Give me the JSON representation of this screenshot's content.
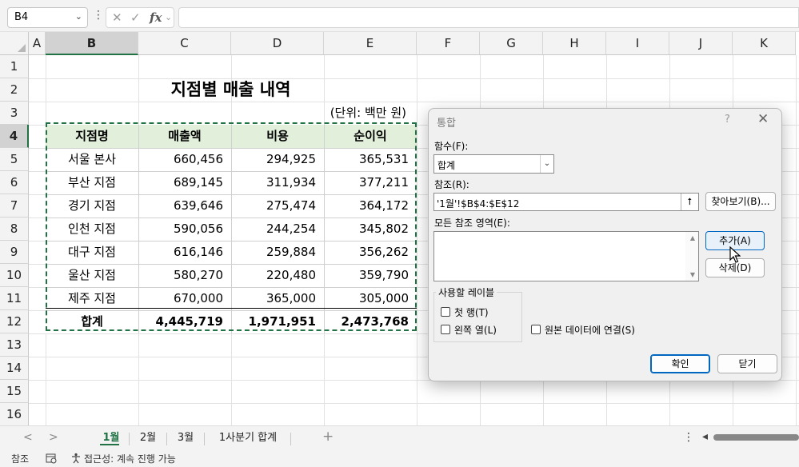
{
  "formula_bar": {
    "name_box": "B4",
    "name_box_dropdown": "⌄",
    "more": "⋮",
    "cancel_symbol": "✕",
    "enter_symbol": "✓",
    "fx_symbol": "fx",
    "fx_dropdown": "⌄",
    "formula": ""
  },
  "grid": {
    "columns": [
      "A",
      "B",
      "C",
      "D",
      "E",
      "F",
      "G",
      "H",
      "I",
      "J",
      "K"
    ],
    "rows": [
      "1",
      "2",
      "3",
      "4",
      "5",
      "6",
      "7",
      "8",
      "9",
      "10",
      "11",
      "12",
      "13",
      "14",
      "15",
      "16"
    ],
    "selected_cell": "B4"
  },
  "sheet": {
    "title": "지점별 매출 내역",
    "unit_note": "(단위: 백만 원)",
    "headers": [
      "지점명",
      "매출액",
      "비용",
      "순이익"
    ],
    "rows": [
      {
        "branch": "서울 본사",
        "sales": "660,456",
        "cost": "294,925",
        "profit": "365,531"
      },
      {
        "branch": "부산 지점",
        "sales": "689,145",
        "cost": "311,934",
        "profit": "377,211"
      },
      {
        "branch": "경기 지점",
        "sales": "639,646",
        "cost": "275,474",
        "profit": "364,172"
      },
      {
        "branch": "인천 지점",
        "sales": "590,056",
        "cost": "244,254",
        "profit": "345,802"
      },
      {
        "branch": "대구 지점",
        "sales": "616,146",
        "cost": "259,884",
        "profit": "356,262"
      },
      {
        "branch": "울산 지점",
        "sales": "580,270",
        "cost": "220,480",
        "profit": "359,790"
      },
      {
        "branch": "제주 지점",
        "sales": "670,000",
        "cost": "365,000",
        "profit": "305,000"
      }
    ],
    "total": {
      "branch": "합계",
      "sales": "4,445,719",
      "cost": "1,971,951",
      "profit": "2,473,768"
    },
    "header_fill": "#e2efda",
    "selection_color": "#217346"
  },
  "dialog": {
    "title": "통합",
    "help": "?",
    "close": "✕",
    "function_label": "함수(F):",
    "function_value": "합계",
    "function_dropdown": "⌄",
    "reference_label": "참조(R):",
    "reference_value": "'1월'!$B$4:$E$12",
    "reference_collapse": "⭡",
    "browse_button": "찾아보기(B)...",
    "all_references_label": "모든 참조 영역(E):",
    "scroll_up": "▲",
    "scroll_down": "▼",
    "add_button": "추가(A)",
    "delete_button": "삭제(D)",
    "use_labels_group": "사용할 레이블",
    "top_row_checkbox": "첫 행(T)",
    "top_row_checked": false,
    "left_column_checkbox": "왼쪽 열(L)",
    "left_column_checked": false,
    "link_source_checkbox": "원본 데이터에 연결(S)",
    "link_source_checked": false,
    "ok_button": "확인",
    "close_button": "닫기"
  },
  "tabs": {
    "prev_arrow": "<",
    "next_arrow": ">",
    "items": [
      "1월",
      "2월",
      "3월",
      "1사분기 합계"
    ],
    "active": "1월",
    "add": "+",
    "more": "⋮",
    "scroll_left": "◂"
  },
  "status_bar": {
    "mode": "참조",
    "accessibility": "접근성: 계속 진행 가능"
  }
}
